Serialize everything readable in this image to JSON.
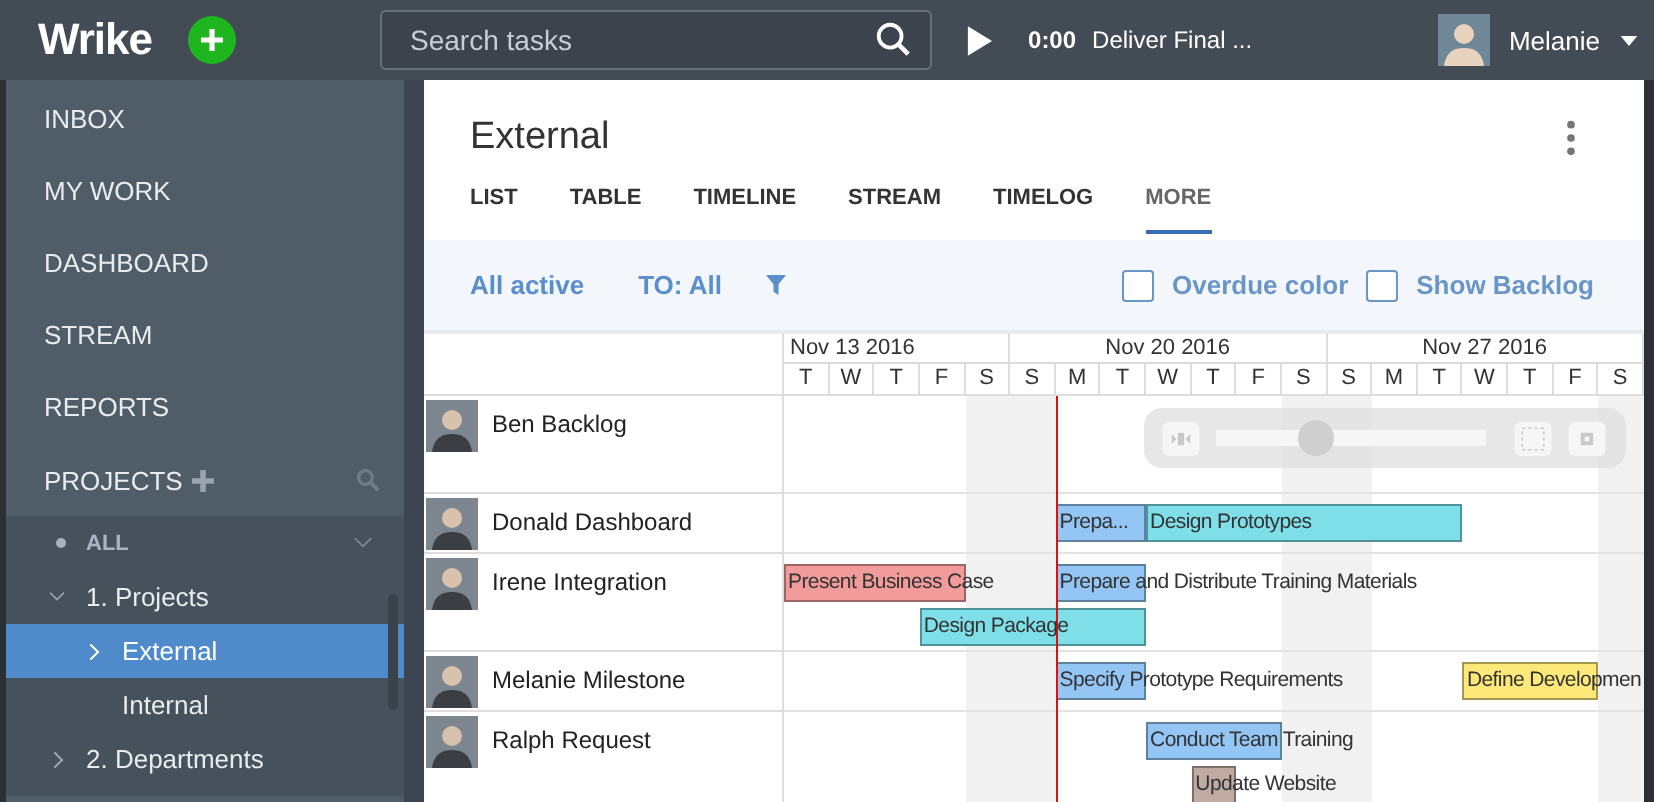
{
  "topbar": {
    "logo": "Wrike",
    "search": {
      "placeholder": "Search tasks"
    },
    "timer": "0:00",
    "timer_task": "Deliver Final ...",
    "user": "Melanie"
  },
  "sidebar": {
    "items": [
      "INBOX",
      "MY WORK",
      "DASHBOARD",
      "STREAM",
      "REPORTS"
    ],
    "projects_label": "PROJECTS",
    "tree": [
      {
        "label": "ALL",
        "kind": "all",
        "selected": false
      },
      {
        "label": "1. Projects",
        "kind": "folder",
        "selected": false,
        "expanded": true,
        "children": [
          {
            "label": "External",
            "selected": true,
            "expanded": false
          },
          {
            "label": "Internal",
            "selected": false
          }
        ]
      },
      {
        "label": "2. Departments",
        "kind": "folder",
        "selected": false,
        "expanded": false
      }
    ]
  },
  "main": {
    "title": "External",
    "tabs": [
      {
        "label": "LIST",
        "selected": false
      },
      {
        "label": "TABLE",
        "selected": false
      },
      {
        "label": "TIMELINE",
        "selected": false
      },
      {
        "label": "STREAM",
        "selected": false
      },
      {
        "label": "TIMELOG",
        "selected": false
      },
      {
        "label": "MORE",
        "selected": true
      }
    ],
    "filters": {
      "status": "All active",
      "assignee": "TO: All",
      "checkboxes": [
        {
          "label": "Overdue color",
          "checked": false
        },
        {
          "label": "Show Backlog",
          "checked": false
        }
      ]
    },
    "gantt": {
      "zoom": {
        "level": 0.37
      },
      "weeks": [
        {
          "label": "Nov 13 2016",
          "days": [
            "T",
            "W",
            "T",
            "F",
            "S"
          ]
        },
        {
          "label": "Nov 20 2016",
          "days": [
            "S",
            "M",
            "T",
            "W",
            "T",
            "F",
            "S"
          ]
        },
        {
          "label": "Nov 27 2016",
          "days": [
            "S",
            "M",
            "T",
            "W",
            "T",
            "F",
            "S"
          ]
        }
      ],
      "people": [
        {
          "name": "Ben Backlog"
        },
        {
          "name": "Donald Dashboard",
          "lanes": [
            [
              {
                "label": "Prepa...",
                "color": "#93c6f4"
              },
              {
                "label": "Design Prototypes",
                "color": "#7fdfe9"
              }
            ]
          ]
        },
        {
          "name": "Irene Integration",
          "lanes": [
            [
              {
                "label": "Present Business Case",
                "color": "#f29b9b"
              },
              {
                "label": "Prepare and Distribute Training Materials",
                "color": "#93c6f4"
              }
            ],
            [
              {
                "label": "Design Package",
                "color": "#7fdfe9"
              }
            ]
          ]
        },
        {
          "name": "Melanie Milestone",
          "lanes": [
            [
              {
                "label": "Specify Prototype Requirements",
                "color": "#93c6f4"
              },
              {
                "label": "Define Developmen",
                "color": "#fde97a"
              }
            ]
          ]
        },
        {
          "name": "Ralph Request",
          "lanes": [
            [
              {
                "label": "Conduct Team Training",
                "color": "#93c6f4"
              }
            ],
            [
              {
                "label": "Update Website",
                "color": "#bfaba2"
              }
            ]
          ]
        }
      ]
    }
  }
}
